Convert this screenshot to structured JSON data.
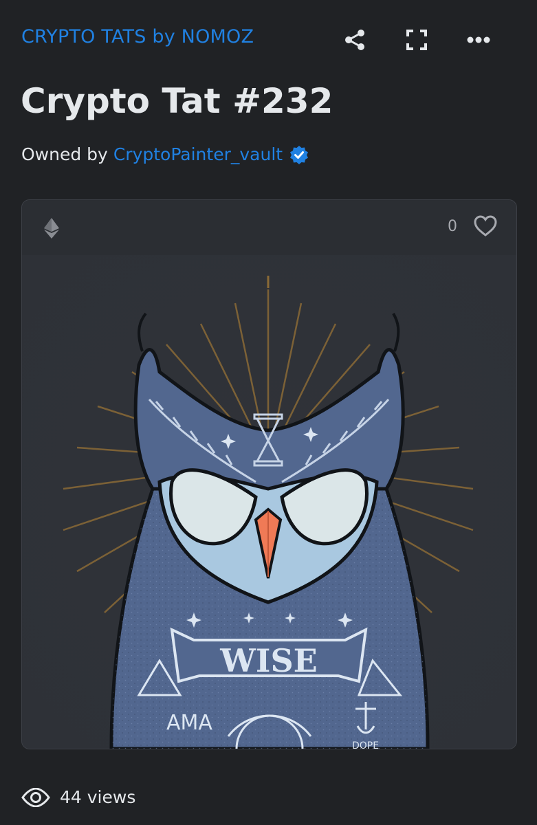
{
  "collection": {
    "name": "CRYPTO TATS by NOMOZ"
  },
  "actions": [
    {
      "name": "share-icon"
    },
    {
      "name": "fullscreen-icon"
    },
    {
      "name": "more-icon"
    }
  ],
  "asset": {
    "title": "Crypto Tat #232",
    "owned_by_label": "Owned by",
    "owner": "CryptoPainter_vault",
    "verified_icon": "verified-badge-icon"
  },
  "card": {
    "chain_icon": "ethereum-icon",
    "like_count": "0",
    "like_icon": "heart-icon",
    "artwork": {
      "subject": "owl-illustration",
      "banner_text": "WISE",
      "side_text": "AMA",
      "anchor_text": "DOPE"
    }
  },
  "stats": {
    "views": "44 views",
    "views_icon": "eye-icon"
  },
  "colors": {
    "background": "#202225",
    "link": "#2081e2",
    "text": "#e5e8eb",
    "card": "#303339",
    "owl_body": "#52678f",
    "beak": "#f07a56"
  }
}
